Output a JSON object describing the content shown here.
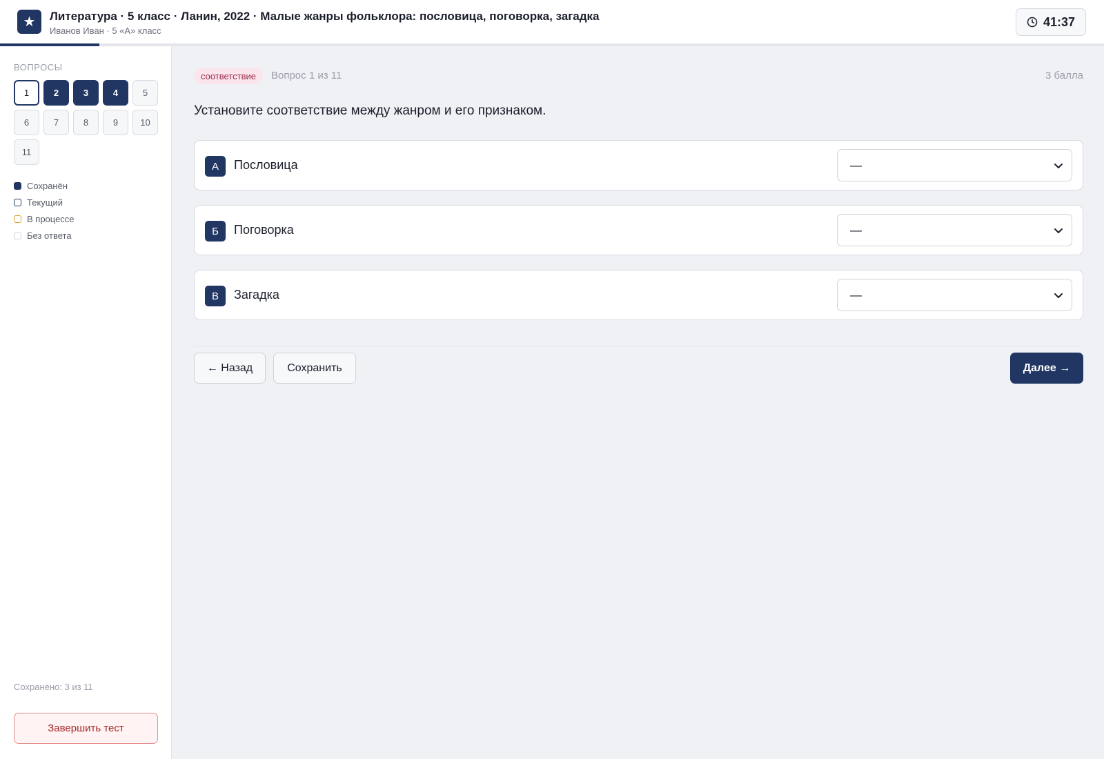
{
  "header": {
    "title": "Литература · 5 класс · Ланин, 2022 · Малые жанры фольклора: пословица, поговорка, загадка",
    "subtitle": "Иванов Иван · 5 «А» класс",
    "timer": "41:37",
    "progress_fraction": 0.09
  },
  "sidebar": {
    "heading": "ВОПРОСЫ",
    "questions": [
      {
        "n": "1",
        "state": "current"
      },
      {
        "n": "2",
        "state": "saved"
      },
      {
        "n": "3",
        "state": "saved"
      },
      {
        "n": "4",
        "state": "saved"
      },
      {
        "n": "5",
        "state": "none"
      },
      {
        "n": "6",
        "state": "none"
      },
      {
        "n": "7",
        "state": "none"
      },
      {
        "n": "8",
        "state": "none"
      },
      {
        "n": "9",
        "state": "none"
      },
      {
        "n": "10",
        "state": "none"
      },
      {
        "n": "11",
        "state": "none"
      }
    ],
    "legend": [
      {
        "label": "Сохранён",
        "kind": "saved"
      },
      {
        "label": "Текущий",
        "kind": "current"
      },
      {
        "label": "В процессе",
        "kind": "progress"
      },
      {
        "label": "Без ответа",
        "kind": "none"
      }
    ],
    "saved_count": "Сохранено: 3 из 11",
    "finish_label": "Завершить тест"
  },
  "main": {
    "type_badge": "соответствие",
    "counter": "Вопрос 1 из 11",
    "points": "3 балла",
    "question": "Установите соответствие между жанром и его признаком.",
    "rows": [
      {
        "letter": "А",
        "label": "Пословица",
        "selected": "—"
      },
      {
        "letter": "Б",
        "label": "Поговорка",
        "selected": "—"
      },
      {
        "letter": "В",
        "label": "Загадка",
        "selected": "—"
      }
    ],
    "back_label": "← Назад",
    "save_label": "Сохранить",
    "next_label": "Далее →"
  },
  "colors": {
    "accent": "#213663",
    "badge_bg": "#fbe5ec",
    "danger": "#a32a2a"
  }
}
